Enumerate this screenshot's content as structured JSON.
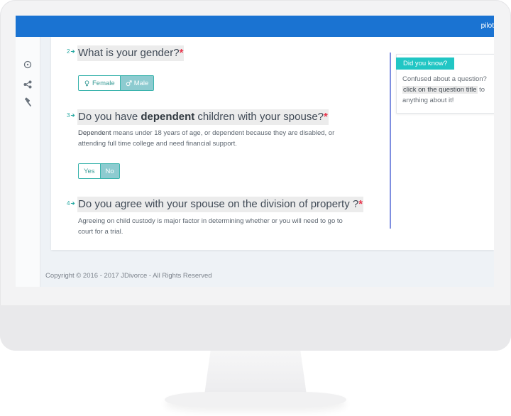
{
  "topbar": {
    "user_label": "pilot"
  },
  "sidebar": {
    "icons": [
      "help-circle-icon",
      "share-icon",
      "hammer-icon"
    ]
  },
  "questions": [
    {
      "number": "2",
      "title": "What is your gender?",
      "required": "*",
      "options": [
        {
          "label": "Female",
          "icon": "female-icon",
          "selected": false
        },
        {
          "label": "Male",
          "icon": "male-icon",
          "selected": true
        }
      ]
    },
    {
      "number": "3",
      "title_pre": "Do you have ",
      "title_bold": "dependent",
      "title_post": " children with your spouse?",
      "required": "*",
      "description_bold": "Dependent",
      "description_line1": " means under 18 years of age, or dependent because they are disabled, or",
      "description_line2": "attending full time college and need financial support.",
      "options": [
        {
          "label": "Yes",
          "selected": false
        },
        {
          "label": "No",
          "selected": true
        }
      ]
    },
    {
      "number": "4",
      "title": "Do you agree with your spouse on the division of property ?",
      "required": "*",
      "description_line1": "Agreeing on child custody is major factor in determining whether or you will need to go to",
      "description_line2": "court for a trial."
    }
  ],
  "did_you_know": {
    "badge": "Did you know?",
    "line1": "Confused about a question?",
    "line2_highlight": "click on the question title",
    "line2_rest": " to",
    "line3": "anything about it!"
  },
  "footer": {
    "copyright": "Copyright © 2016 - 2017 JDivorce - All Rights Reserved"
  },
  "colors": {
    "topbar": "#1a73d2",
    "accent": "#21a7a0",
    "selected_button": "#8dcbd0",
    "required": "#e8334a",
    "badge": "#21c6c4"
  }
}
